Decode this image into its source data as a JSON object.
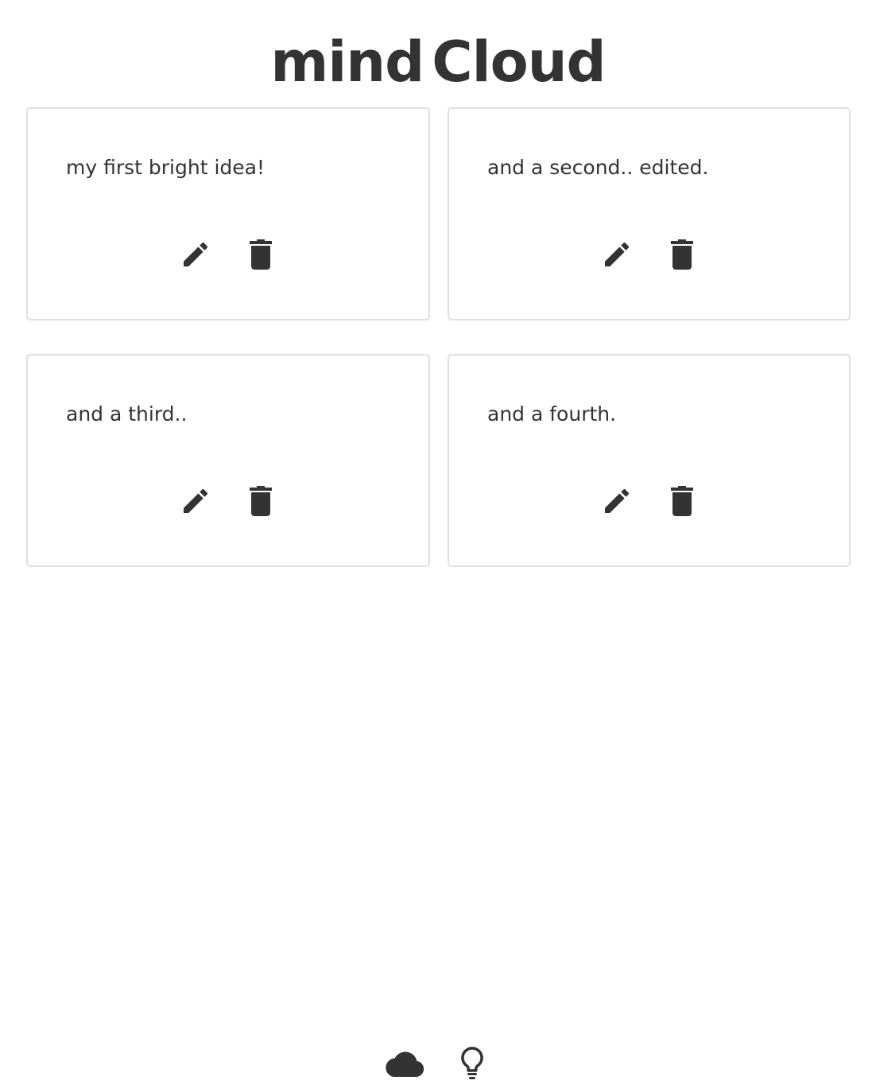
{
  "header": {
    "title_part1": "mind",
    "title_part2": "Cloud"
  },
  "ideas": [
    {
      "text": "my first bright idea!"
    },
    {
      "text": "and a second.. edited."
    },
    {
      "text": "and a third.."
    },
    {
      "text": "and a fourth."
    }
  ],
  "icons": {
    "edit": "pencil-icon",
    "delete": "trash-icon",
    "footer_left": "cloud-icon",
    "footer_right": "lightbulb-icon"
  },
  "colors": {
    "text": "#333333",
    "card_border": "#e0e0e0",
    "background": "#ffffff"
  }
}
